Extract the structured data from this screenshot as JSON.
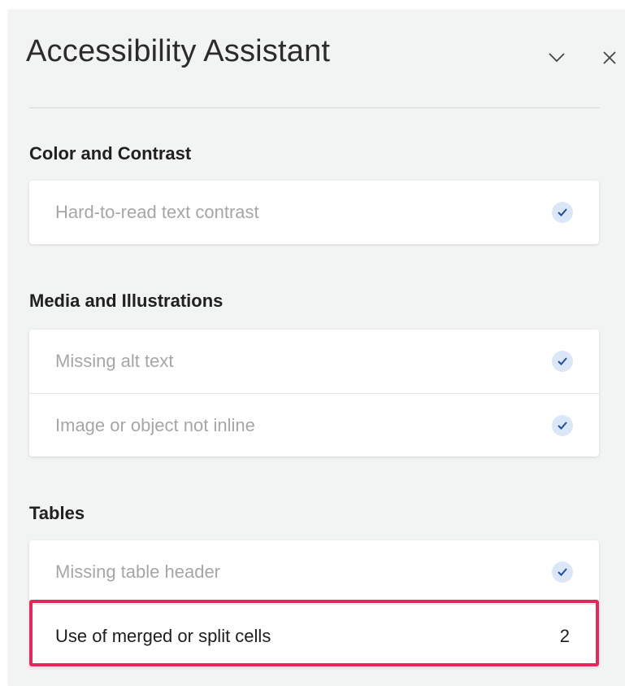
{
  "pane": {
    "title": "Accessibility Assistant",
    "collapse_icon": "chevron-down-icon",
    "close_icon": "close-icon"
  },
  "sections": [
    {
      "title": "Color and Contrast",
      "items": [
        {
          "label": "Hard-to-read text contrast",
          "status": "check-icon"
        }
      ]
    },
    {
      "title": "Media and Illustrations",
      "items": [
        {
          "label": "Missing alt text",
          "status": "check-icon"
        },
        {
          "label": "Image or object not inline",
          "status": "check-icon"
        }
      ]
    },
    {
      "title": "Tables",
      "items": [
        {
          "label": "Missing table header",
          "status": "check-icon"
        },
        {
          "label": "Use of merged or split cells",
          "count": "2"
        }
      ]
    }
  ],
  "colors": {
    "panel_bg": "#f2f3f3",
    "check_bg": "#dbe6f6",
    "check_mark": "#1f4e9c",
    "highlight_border": "#e3295c",
    "resolved_text": "#a6a6a6"
  }
}
